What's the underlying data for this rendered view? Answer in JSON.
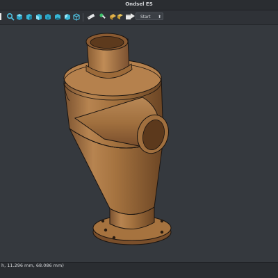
{
  "window": {
    "title": "Ondsel ES"
  },
  "toolbar": {
    "icons": [
      "select-icon",
      "zoom-icon",
      "view-cube-front-icon",
      "view-cube-top-icon",
      "view-cube-right-icon",
      "view-cube-rear-icon",
      "view-cube-bottom-icon",
      "view-cube-left-icon",
      "isometric-icon",
      "measure-icon",
      "link-icon",
      "part-icon",
      "group-icon",
      "folder-icon"
    ],
    "workbench": {
      "selected": "Start"
    }
  },
  "status": {
    "coordinates": "h, 11.296 mm, 68.086 mm)"
  },
  "colors": {
    "model": "#a6733f",
    "model_light": "#c08a52",
    "model_dark": "#6f4a27",
    "edge": "#1a1410",
    "background": "#35393e",
    "accent_icon": "#37b6d6"
  }
}
